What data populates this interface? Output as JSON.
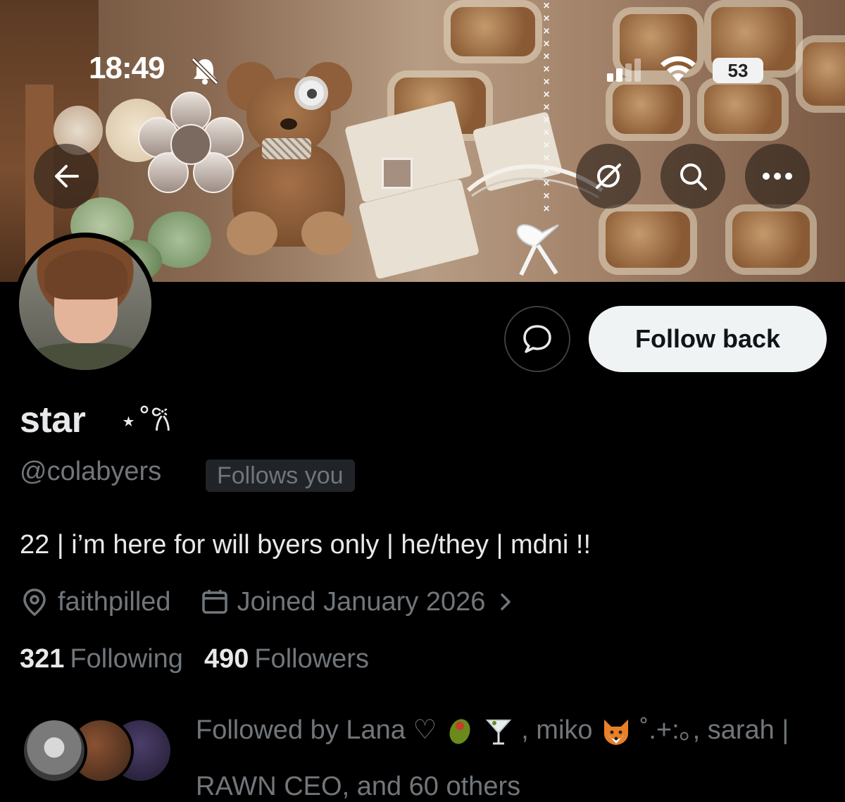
{
  "status_bar": {
    "time": "18:49",
    "battery": "53",
    "icons": [
      "bell-muted-icon",
      "cellular-signal-icon",
      "wifi-icon",
      "battery-icon"
    ]
  },
  "header": {
    "back_icon": "arrow-left-icon",
    "actions": [
      "grok-icon",
      "search-icon",
      "more-icon"
    ]
  },
  "profile": {
    "display_name": "star",
    "display_name_decoration": "⋆˚𐙚",
    "handle": "@colabyers",
    "follows_you_badge": "Follows you",
    "follow_button": "Follow back",
    "message_icon": "message-bubble-icon",
    "bio": "22 | i’m here for will byers only | he/they | mdni !!",
    "location": "faithpilled",
    "joined": "Joined January 2026",
    "following_count": "321",
    "following_label": "Following",
    "followers_count": "490",
    "followers_label": "Followers",
    "followed_by_prefix": "Followed by",
    "followed_by_name1": "Lana ♡",
    "followed_by_name2": ", miko",
    "followed_by_name2_suffix": "˚.+:｡, sarah |",
    "followed_by_line2": "RAWN CEO, and 60 others"
  },
  "colors": {
    "background": "#000000",
    "text_primary": "#e7e9ea",
    "text_secondary": "#71767b",
    "button_light": "#eff3f4"
  }
}
